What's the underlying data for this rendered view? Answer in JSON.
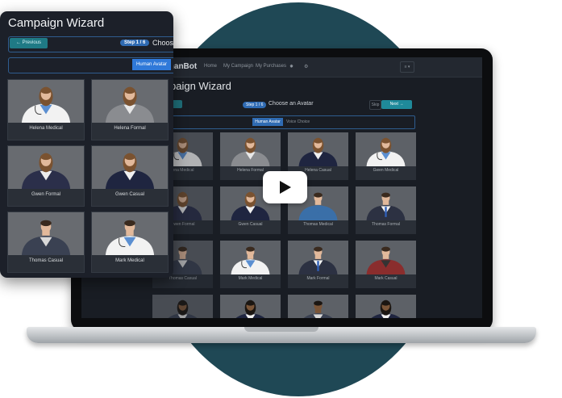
{
  "popup": {
    "title": "Campaign Wizard",
    "previous_label": "← Previous",
    "step_badge": "Step 1 / 6",
    "step_label": "Choose",
    "tab_human_avatar": "Human Avatar",
    "avatars": [
      {
        "name": "Helena Medical"
      },
      {
        "name": "Helena Formal"
      },
      {
        "name": "Gwen Formal"
      },
      {
        "name": "Gwen Casual"
      },
      {
        "name": "Thomas Casual"
      },
      {
        "name": "Mark Medical"
      }
    ]
  },
  "inner": {
    "nav": {
      "brand": "manBot",
      "links": [
        "Home",
        "My Campaign",
        "My Purchases"
      ],
      "icon_a": "✸",
      "icon_b": "⚙",
      "menu_button": "≡ ▾"
    },
    "title": "paign Wizard",
    "step_badge": "Step 1 / 6",
    "step_label": "Choose an Avatar",
    "skip_label": "Skip",
    "next_label": "Next →",
    "tab_human_avatar": "Human Avatar",
    "tab_other": "Voice Choice",
    "avatars": [
      {
        "name": "lena Medical"
      },
      {
        "name": "Helena Formal"
      },
      {
        "name": "Helena Casual"
      },
      {
        "name": "Gwen Medical"
      },
      {
        "name": "Gwen Formal"
      },
      {
        "name": "Gwen Casual"
      },
      {
        "name": "Thomas Medical"
      },
      {
        "name": "Thomas Formal"
      },
      {
        "name": "Thomas Casual"
      },
      {
        "name": "Mark Medical"
      },
      {
        "name": "Mark Formal"
      },
      {
        "name": "Mark Casual"
      },
      {
        "name": ""
      },
      {
        "name": ""
      },
      {
        "name": ""
      },
      {
        "name": ""
      }
    ]
  },
  "play_icon": "play-icon",
  "colors": {
    "circle": "#1f4855",
    "accent_blue": "#2f79d9",
    "teal": "#1f7a85"
  }
}
